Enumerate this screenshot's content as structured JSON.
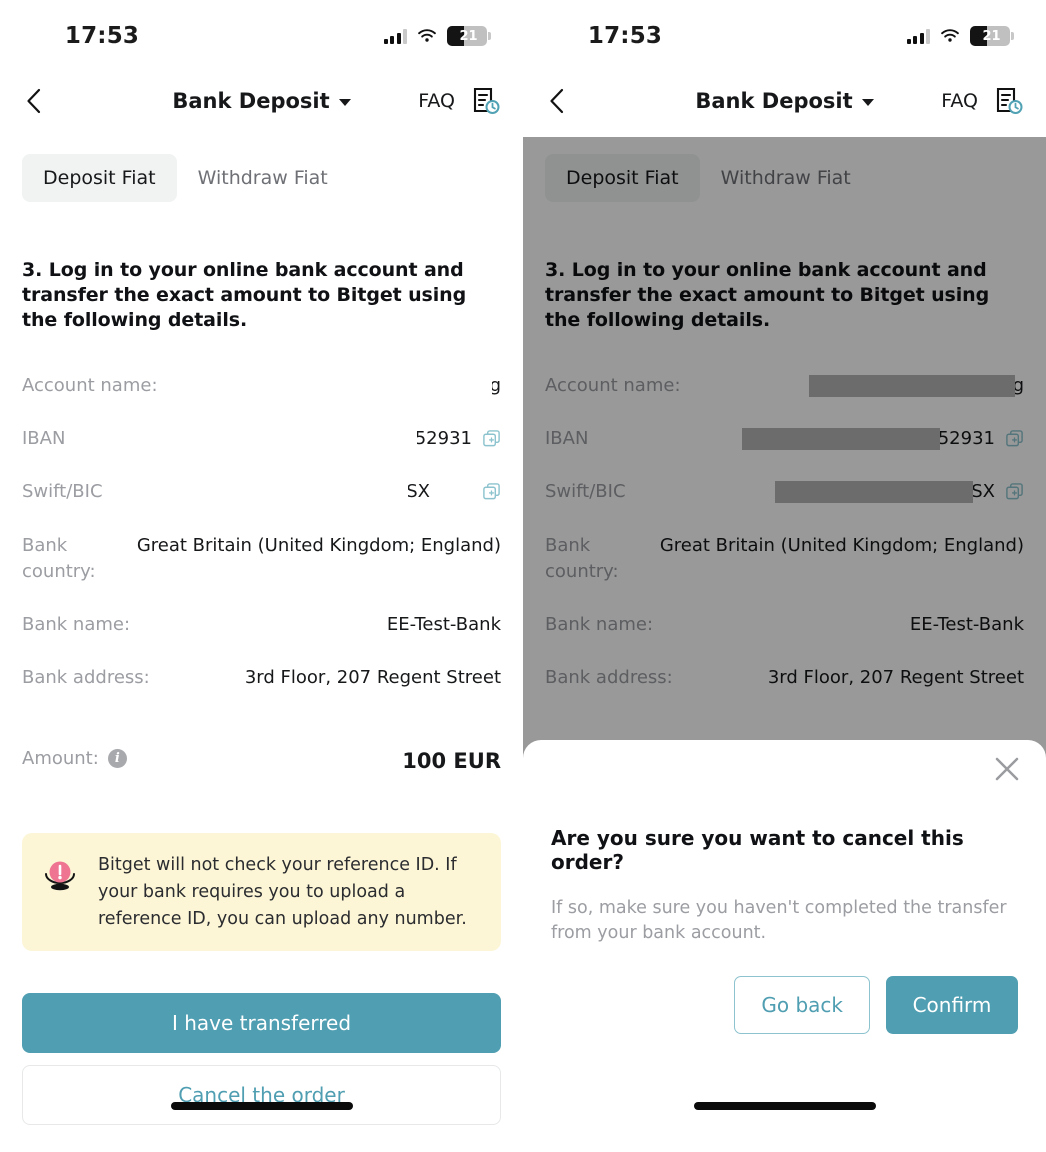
{
  "status_bar": {
    "time": "17:53",
    "battery_level": "21",
    "icons": [
      "cellular-signal-icon",
      "wifi-icon",
      "battery-icon"
    ]
  },
  "header": {
    "back_icon": "back-chevron-icon",
    "title": "Bank Deposit",
    "dropdown_icon": "chevron-down-icon",
    "faq_label": "FAQ",
    "order_history_icon": "document-clock-icon"
  },
  "tabs": [
    {
      "label": "Deposit Fiat",
      "active": true
    },
    {
      "label": "Withdraw Fiat",
      "active": false
    }
  ],
  "step": {
    "title": "3. Log in to your online bank account and transfer the exact amount to Bitget using the following details."
  },
  "details": [
    {
      "key": "Account name:",
      "value": "g",
      "copyable": false,
      "redacted": true,
      "redact_width": 206
    },
    {
      "key": "IBAN",
      "value": "52931",
      "copyable": true,
      "redacted": true,
      "redact_width": 198
    },
    {
      "key": "Swift/BIC",
      "value": "SX",
      "copyable": true,
      "redacted": true,
      "redact_width": 198
    },
    {
      "key": "Bank country:",
      "value": "Great Britain (United Kingdom; England)",
      "copyable": false,
      "redacted": false
    },
    {
      "key": "Bank name:",
      "value": "EE-Test-Bank",
      "copyable": false,
      "redacted": false
    },
    {
      "key": "Bank address:",
      "value": "3rd Floor, 207 Regent Street",
      "copyable": false,
      "redacted": false
    }
  ],
  "amount_row": {
    "key": "Amount:",
    "info_icon": "info-icon",
    "value": "100 EUR"
  },
  "warning": {
    "icon": "alert-exclamation-icon",
    "text": "Bitget will not check your reference ID. If your bank requires you to upload a reference ID, you can upload any number."
  },
  "actions": {
    "primary_label": "I have transferred",
    "secondary_label": "Cancel the order"
  },
  "modal": {
    "close_icon": "close-icon",
    "title": "Are you sure you want to cancel this order?",
    "subtitle": "If so, make sure you haven't completed the transfer from your bank account.",
    "go_back_label": "Go back",
    "confirm_label": "Confirm"
  },
  "colors": {
    "accent_teal": "#4f9eb1",
    "warning_bg": "#fcf6d7",
    "warning_icon": "#ee6f8e",
    "muted_text": "#9b9da2",
    "tab_active_bg": "#f1f3f3"
  },
  "home_indicator": "home-indicator"
}
